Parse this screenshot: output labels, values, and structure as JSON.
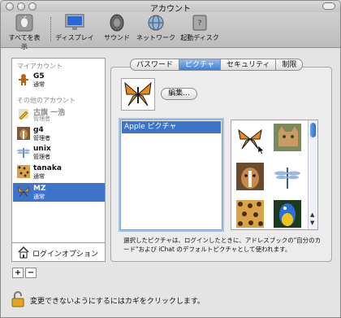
{
  "window": {
    "title": "アカウント"
  },
  "toolbar": {
    "items": [
      {
        "label": "すべてを表示",
        "icon": "apple-icon"
      },
      {
        "label": "ディスプレイ",
        "icon": "display-icon"
      },
      {
        "label": "サウンド",
        "icon": "speaker-icon"
      },
      {
        "label": "ネットワーク",
        "icon": "network-globe-icon"
      },
      {
        "label": "起動ディスク",
        "icon": "startup-disk-icon"
      }
    ]
  },
  "sidebar": {
    "my_account_header": "マイアカウント",
    "other_accounts_header": "その他のアカウント",
    "my_account": {
      "name": "G5",
      "role": "通常",
      "picture": "gingerbread-icon"
    },
    "others": [
      {
        "name": "古旗 一浩",
        "role": "管理者",
        "picture": "pencil-icon",
        "locked": true
      },
      {
        "name": "g4",
        "role": "管理者",
        "picture": "dog-icon"
      },
      {
        "name": "unix",
        "role": "管理者",
        "picture": "dragonfly-icon"
      },
      {
        "name": "tanaka",
        "role": "通常",
        "picture": "leopard-icon"
      },
      {
        "name": "MZ",
        "role": "通常",
        "picture": "butterfly-icon",
        "selected": true
      }
    ],
    "login_options": "ログインオプション",
    "add_label": "+",
    "remove_label": "−"
  },
  "tabs": [
    "パスワード",
    "ピクチャ",
    "セキュリティ",
    "制限"
  ],
  "active_tab": "ピクチャ",
  "picture": {
    "edit_label": "編集...",
    "source_list": [
      "Apple ピクチャ"
    ],
    "grid": [
      "butterfly-icon",
      "cat-icon",
      "dog-icon",
      "dragonfly-icon",
      "leopard-icon",
      "parrot-icon"
    ],
    "description": "選択したピクチャは、ログインしたときに、アドレスブックの\"自分のカード\"および iChat のデフォルトピクチャとして使われます。"
  },
  "lock": {
    "text": "変更できないようにするにはカギをクリックします。",
    "icon": "lock-icon"
  }
}
